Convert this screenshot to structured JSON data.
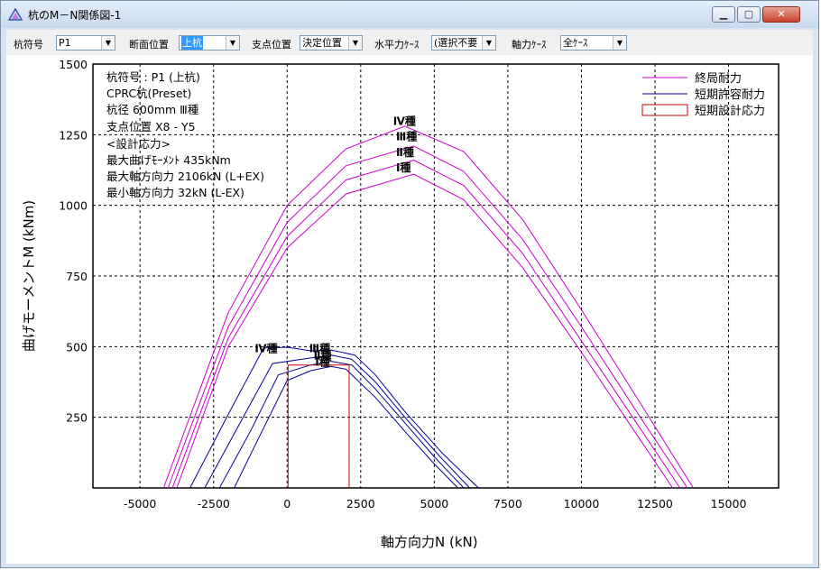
{
  "window": {
    "title": "杭のM－N関係図-1",
    "buttons": {
      "minimize": "▁",
      "maximize": "▢",
      "close": "✕"
    }
  },
  "toolbar": {
    "pile_label": "杭符号",
    "pile_value": "P1",
    "section_label": "断面位置",
    "section_value": "上杭",
    "support_label": "支点位置",
    "support_value": "決定位置",
    "horizontal_label": "水平力ｹｰｽ",
    "horizontal_value": "(選択不要",
    "axial_label": "軸力ｹｰｽ",
    "axial_value": "全ｹｰｽ"
  },
  "info": {
    "line1": "杭符号 : P1 (上杭)",
    "line2": "CPRC杭(Preset)",
    "line3": "杭径 600mm Ⅲ種",
    "line4": "支点位置 X8 - Y5",
    "line5": "<設計応力>",
    "line6": "最大曲げﾓｰﾒﾝﾄ  435kNm",
    "line7": "最大軸方向力  2106kN (L+EX)",
    "line8": "最小軸方向力    32kN (L-EX)"
  },
  "colors": {
    "ultimate": "#cc00cc",
    "allowable": "#000099",
    "design": "#cc0000",
    "grid": "#000000"
  },
  "chart_data": {
    "type": "line",
    "xlabel": "軸方向力N (kN)",
    "ylabel": "曲げモーメントM (kNm)",
    "xlim": [
      -6600,
      16700
    ],
    "ylim": [
      0,
      1500
    ],
    "x_ticks": [
      -5000,
      -2500,
      0,
      2500,
      5000,
      7500,
      10000,
      12500,
      15000
    ],
    "y_ticks": [
      250,
      500,
      750,
      1000,
      1250,
      1500
    ],
    "grid": true,
    "legend_position": "top-right",
    "legend": [
      "終局耐力",
      "短期許容耐力",
      "短期設計応力"
    ],
    "series": [
      {
        "name": "終局耐力",
        "type": "Ⅰ種",
        "points": [
          [
            -3750,
            0
          ],
          [
            -2000,
            500
          ],
          [
            0,
            850
          ],
          [
            2000,
            1040
          ],
          [
            4300,
            1110
          ],
          [
            6000,
            1020
          ],
          [
            8000,
            780
          ],
          [
            10000,
            480
          ],
          [
            12000,
            170
          ],
          [
            13100,
            0
          ]
        ]
      },
      {
        "name": "終局耐力",
        "type": "Ⅱ種",
        "points": [
          [
            -3900,
            0
          ],
          [
            -2000,
            530
          ],
          [
            0,
            890
          ],
          [
            2000,
            1090
          ],
          [
            4300,
            1160
          ],
          [
            6000,
            1070
          ],
          [
            8000,
            830
          ],
          [
            10000,
            520
          ],
          [
            12000,
            210
          ],
          [
            13350,
            0
          ]
        ]
      },
      {
        "name": "終局耐力",
        "type": "Ⅲ種",
        "points": [
          [
            -4050,
            0
          ],
          [
            -2000,
            570
          ],
          [
            0,
            940
          ],
          [
            2000,
            1140
          ],
          [
            4300,
            1210
          ],
          [
            6000,
            1120
          ],
          [
            8000,
            880
          ],
          [
            10000,
            570
          ],
          [
            12000,
            250
          ],
          [
            13600,
            0
          ]
        ]
      },
      {
        "name": "終局耐力",
        "type": "Ⅳ種",
        "points": [
          [
            -4200,
            0
          ],
          [
            -2000,
            620
          ],
          [
            0,
            1000
          ],
          [
            2000,
            1200
          ],
          [
            4000,
            1280
          ],
          [
            6000,
            1190
          ],
          [
            8000,
            950
          ],
          [
            10000,
            630
          ],
          [
            12000,
            300
          ],
          [
            13800,
            0
          ]
        ]
      },
      {
        "name": "短期許容耐力",
        "type": "Ⅰ種",
        "points": [
          [
            -1800,
            0
          ],
          [
            -1000,
            170
          ],
          [
            0,
            380
          ],
          [
            800,
            415
          ],
          [
            1500,
            430
          ],
          [
            2000,
            420
          ],
          [
            3000,
            320
          ],
          [
            4000,
            200
          ],
          [
            5000,
            85
          ],
          [
            5800,
            0
          ]
        ]
      },
      {
        "name": "短期許容耐力",
        "type": "Ⅱ種",
        "points": [
          [
            -2300,
            0
          ],
          [
            -1200,
            210
          ],
          [
            -300,
            400
          ],
          [
            800,
            435
          ],
          [
            1500,
            448
          ],
          [
            2200,
            435
          ],
          [
            3000,
            350
          ],
          [
            4000,
            230
          ],
          [
            5000,
            110
          ],
          [
            6000,
            0
          ]
        ]
      },
      {
        "name": "短期許容耐力",
        "type": "Ⅲ種",
        "points": [
          [
            -2800,
            0
          ],
          [
            -1600,
            230
          ],
          [
            -500,
            440
          ],
          [
            800,
            460
          ],
          [
            1500,
            470
          ],
          [
            2200,
            455
          ],
          [
            3000,
            375
          ],
          [
            4000,
            250
          ],
          [
            5200,
            110
          ],
          [
            6200,
            0
          ]
        ]
      },
      {
        "name": "短期許容耐力",
        "type": "Ⅳ種",
        "points": [
          [
            -3300,
            0
          ],
          [
            -2000,
            260
          ],
          [
            -800,
            495
          ],
          [
            0,
            498
          ],
          [
            800,
            485
          ],
          [
            1500,
            488
          ],
          [
            2300,
            470
          ],
          [
            3000,
            400
          ],
          [
            4000,
            270
          ],
          [
            5300,
            120
          ],
          [
            6500,
            0
          ]
        ]
      },
      {
        "name": "短期設計応力",
        "points": [
          [
            32,
            0
          ],
          [
            32,
            435
          ],
          [
            2106,
            435
          ],
          [
            2106,
            0
          ]
        ]
      }
    ],
    "annotations": [
      {
        "text": "Ⅳ種",
        "x": 3600,
        "y": 1285
      },
      {
        "text": "Ⅲ種",
        "x": 3700,
        "y": 1230
      },
      {
        "text": "Ⅱ種",
        "x": 3700,
        "y": 1175
      },
      {
        "text": "Ⅰ種",
        "x": 3700,
        "y": 1120
      },
      {
        "text": "Ⅳ種",
        "x": -1100,
        "y": 480
      },
      {
        "text": "Ⅲ種",
        "x": 750,
        "y": 480
      },
      {
        "text": "Ⅱ種",
        "x": 900,
        "y": 455
      },
      {
        "text": "Ⅰ種",
        "x": 950,
        "y": 432
      }
    ]
  }
}
